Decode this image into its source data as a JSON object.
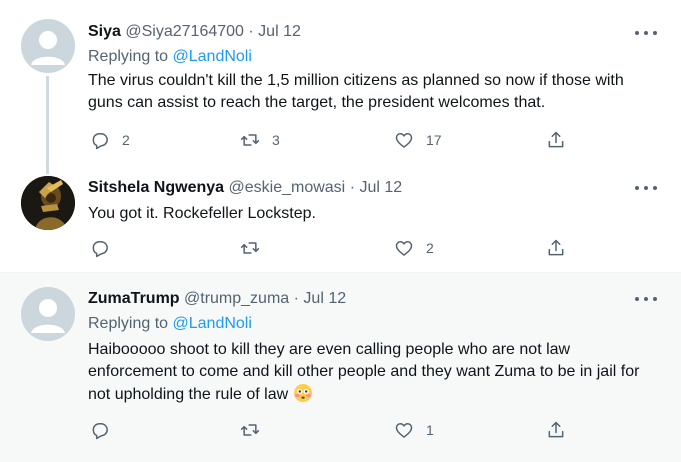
{
  "tweets": [
    {
      "name": "Siya",
      "handle": "@Siya27164700",
      "separator": "·",
      "date": "Jul 12",
      "replying_prefix": "Replying to",
      "replying_to": "@LandNoli",
      "text": "The virus couldn't kill the 1,5 million citizens as planned so now if those with guns can assist to reach the target, the president welcomes that.",
      "reply_count": "2",
      "retweet_count": "3",
      "like_count": "17",
      "avatar": "default-profile-icon"
    },
    {
      "name": "Sitshela Ngwenya",
      "handle": "@eskie_mowasi",
      "separator": "·",
      "date": "Jul 12",
      "text": "You got it. Rockefeller Lockstep.",
      "reply_count": "",
      "retweet_count": "",
      "like_count": "2",
      "avatar": "photo-avatar"
    },
    {
      "name": "ZumaTrump",
      "handle": "@trump_zuma",
      "separator": "·",
      "date": "Jul 12",
      "replying_prefix": "Replying to",
      "replying_to": "@LandNoli",
      "text": "Haibooooo shoot to kill they are even calling people who are not law enforcement to come and kill other people and they want Zuma to be in jail for not upholding the rule of law",
      "emoji": "flushed-face-emoji",
      "reply_count": "",
      "retweet_count": "",
      "like_count": "1",
      "avatar": "default-profile-icon"
    }
  ],
  "colors": {
    "text": "#0f1419",
    "secondary": "#536471",
    "link": "#1d9bf0",
    "thread_line": "#cfd9de",
    "highlight_bg": "#f7f9f9"
  }
}
